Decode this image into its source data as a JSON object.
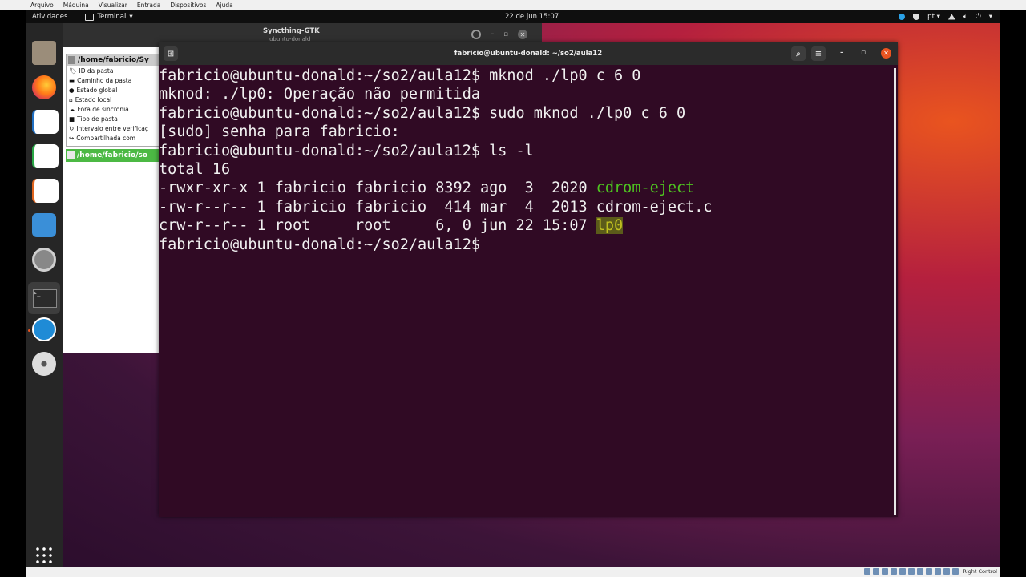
{
  "host_menu": [
    "Arquivo",
    "Máquina",
    "Visualizar",
    "Entrada",
    "Dispositivos",
    "Ajuda"
  ],
  "topbar": {
    "activities": "Atividades",
    "app_name": "Terminal",
    "clock": "22 de jun  15:07",
    "lang": "pt"
  },
  "syncthing": {
    "title": "Syncthing-GTK",
    "subtitle": "ubuntu-donald",
    "folder1": "/home/fabricio/Sy",
    "rows": [
      "ID da pasta",
      "Caminho da pasta",
      "Estado global",
      "Estado local",
      "Fora de sincronia",
      "Tipo de pasta",
      "Intervalo entre verificaç",
      "Compartilhada com"
    ],
    "folder2": "/home/fabricio/so"
  },
  "terminal": {
    "title": "fabricio@ubuntu-donald: ~/so2/aula12",
    "lines": {
      "l1": "fabricio@ubuntu-donald:~/so2/aula12$ mknod ./lp0 c 6 0",
      "l2": "mknod: ./lp0: Operação não permitida",
      "l3": "fabricio@ubuntu-donald:~/so2/aula12$ sudo mknod ./lp0 c 6 0",
      "l4": "[sudo] senha para fabricio:",
      "l5": "fabricio@ubuntu-donald:~/so2/aula12$ ls -l",
      "l6": "total 16",
      "l7a": "-rwxr-xr-x 1 fabricio fabricio 8392 ago  3  2020 ",
      "l7b": "cdrom-eject",
      "l8": "-rw-r--r-- 1 fabricio fabricio  414 mar  4  2013 cdrom-eject.c",
      "l9a": "crw-r--r-- 1 root     root     6, 0 jun 22 15:07 ",
      "l9b": "lp0",
      "l10": "fabricio@ubuntu-donald:~/so2/aula12$ "
    }
  },
  "vb_status": {
    "right_control": "Right Control"
  }
}
